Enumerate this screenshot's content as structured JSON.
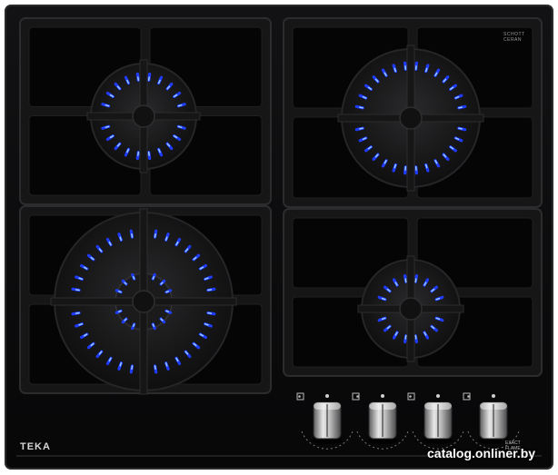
{
  "product": {
    "brand": "TEKA",
    "glass_line1": "SCHOTT",
    "glass_line2": "CERAN",
    "feature_line1": "EXACT",
    "feature_line2": "FLAME"
  },
  "watermark": "catalog.onliner.by",
  "colors": {
    "glass": "#0c0c0d",
    "grate": "#161617",
    "grate_edge": "#2c2c2e",
    "flame_outer": "#1f3cff",
    "flame_inner": "#9fd3ff",
    "knob_metal": "#c9c9c9"
  },
  "burners": [
    {
      "name": "rear-left",
      "rings": 1
    },
    {
      "name": "front-left-wok",
      "rings": 2
    },
    {
      "name": "rear-right",
      "rings": 1
    },
    {
      "name": "front-right",
      "rings": 1
    }
  ],
  "knobs": [
    {
      "name": "knob-1",
      "icon": "burner-position-icon"
    },
    {
      "name": "knob-2",
      "icon": "burner-position-icon"
    },
    {
      "name": "knob-3",
      "icon": "burner-position-icon"
    },
    {
      "name": "knob-4",
      "icon": "burner-position-icon"
    }
  ]
}
